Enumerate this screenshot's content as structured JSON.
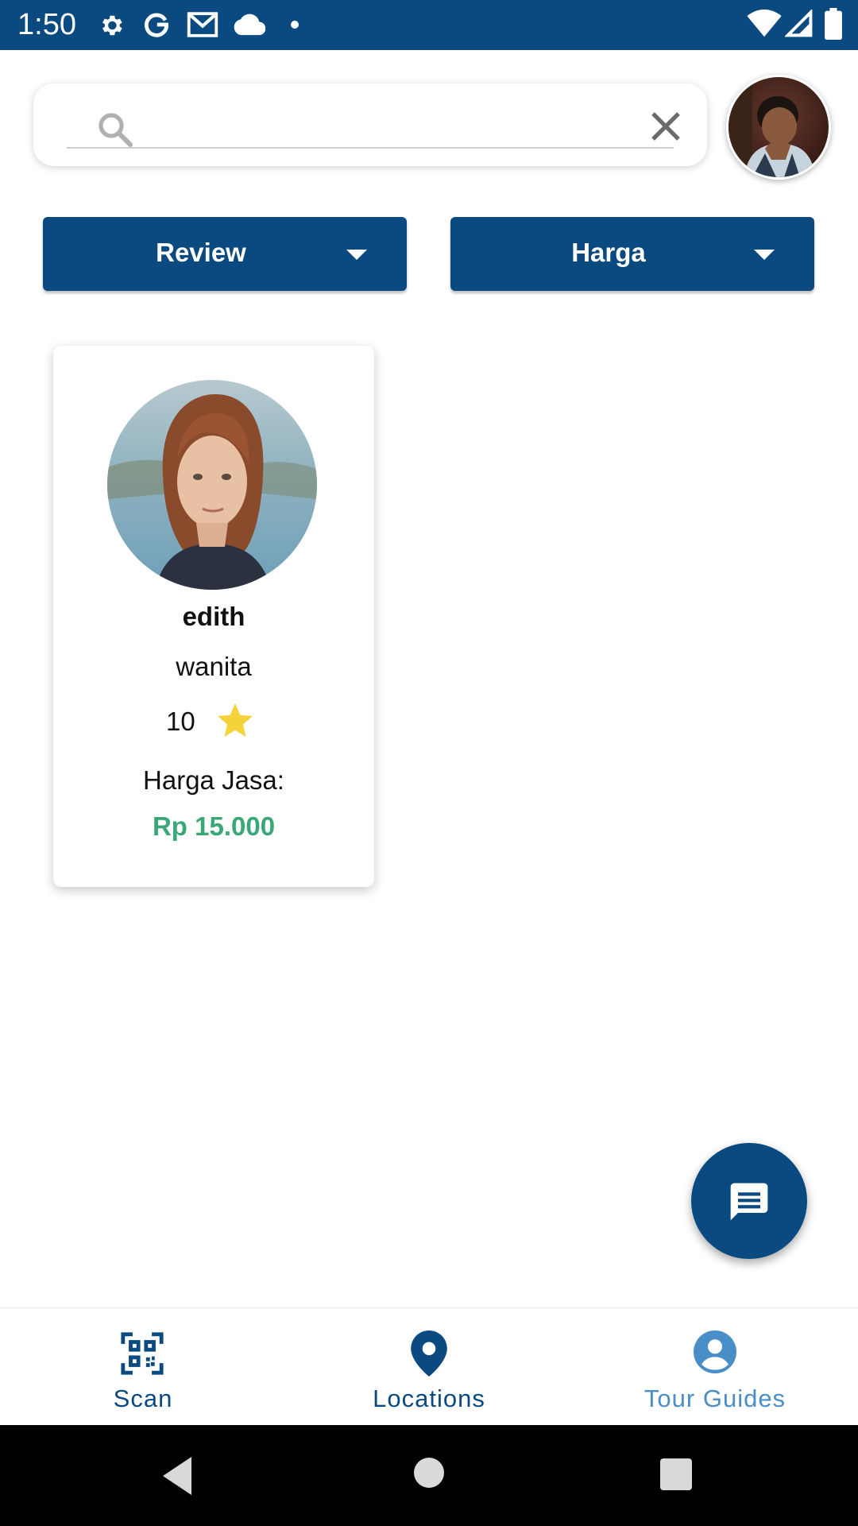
{
  "status_bar": {
    "time": "1:50",
    "icons": [
      "gear-icon",
      "google-icon",
      "gmail-icon",
      "cloud-icon",
      "dot-icon",
      "wifi-icon",
      "signal-icon",
      "battery-icon"
    ]
  },
  "search": {
    "value": "",
    "placeholder": ""
  },
  "filters": [
    {
      "label": "Review"
    },
    {
      "label": "Harga"
    }
  ],
  "guides": [
    {
      "name": "edith",
      "gender": "wanita",
      "rating": "10",
      "price_label": "Harga Jasa:",
      "price": "Rp 15.000"
    }
  ],
  "bottom_nav": {
    "items": [
      {
        "label": "Scan",
        "icon": "qr-scan-icon"
      },
      {
        "label": "Locations",
        "icon": "location-pin-icon"
      },
      {
        "label": "Tour Guides",
        "icon": "account-circle-icon"
      }
    ],
    "active_index": 2
  },
  "colors": {
    "primary": "#0b4a80",
    "active_tab": "#4a8ec7",
    "price": "#3aa876",
    "star": "#f6d23a"
  }
}
